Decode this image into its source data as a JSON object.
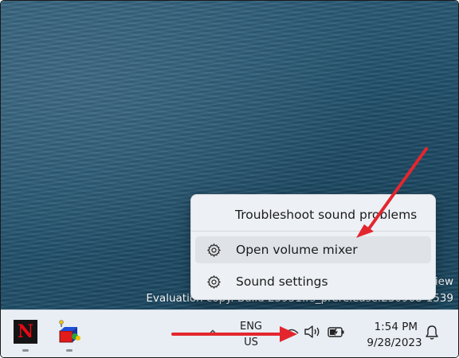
{
  "desktop": {
    "watermark_line1": "view",
    "watermark_line2": "Evaluation copy. Build 25951.rs_prerelease.230908-1539"
  },
  "context_menu": {
    "items": [
      {
        "label": "Troubleshoot sound problems",
        "icon": null
      },
      {
        "label": "Open volume mixer",
        "icon": "gear-icon"
      },
      {
        "label": "Sound settings",
        "icon": "gear-icon"
      }
    ]
  },
  "taskbar": {
    "apps": [
      {
        "name": "Netflix",
        "glyph": "N",
        "icon": "netflix-icon"
      },
      {
        "name": "Paint 3D",
        "icon": "paint-3d-icon"
      }
    ],
    "tray": {
      "overflow_icon": "chevron-up-icon",
      "language_line1": "ENG",
      "language_line2": "US",
      "network_icon": "network-icon",
      "volume_icon": "speaker-icon",
      "battery_icon": "battery-charging-icon"
    },
    "clock": {
      "time": "1:54 PM",
      "date": "9/28/2023"
    },
    "notifications_icon": "bell-icon"
  },
  "annotations": {
    "arrow_color": "#e3262e"
  },
  "colors": {
    "menu_background": "#edf0f4",
    "menu_hover": "#dfe3e8",
    "taskbar_background": "#e9eef5"
  }
}
